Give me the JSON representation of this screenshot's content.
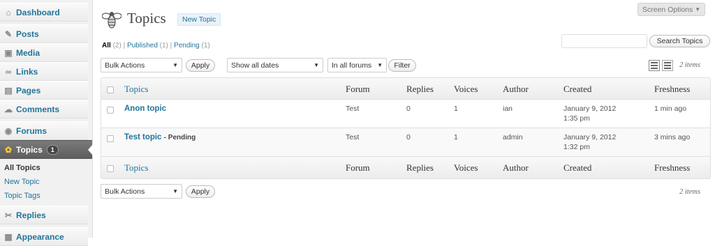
{
  "sidebar": {
    "items": [
      {
        "label": "Dashboard",
        "icon": "home-icon"
      },
      {
        "label": "Posts",
        "icon": "pin-icon"
      },
      {
        "label": "Media",
        "icon": "media-icon"
      },
      {
        "label": "Links",
        "icon": "link-icon"
      },
      {
        "label": "Pages",
        "icon": "pages-icon"
      },
      {
        "label": "Comments",
        "icon": "comment-icon"
      },
      {
        "label": "Forums",
        "icon": "forums-icon"
      },
      {
        "label": "Topics",
        "icon": "topics-icon",
        "badge": "1"
      },
      {
        "label": "Replies",
        "icon": "replies-icon"
      },
      {
        "label": "Appearance",
        "icon": "appearance-icon"
      }
    ],
    "submenu": [
      "All Topics",
      "New Topic",
      "Topic Tags"
    ]
  },
  "screen_options": "Screen Options",
  "page": {
    "title": "Topics",
    "add_new": "New Topic"
  },
  "filters": {
    "all": "All",
    "all_count": "(2)",
    "published": "Published",
    "published_count": "(1)",
    "pending": "Pending",
    "pending_count": "(1)"
  },
  "search": {
    "button": "Search Topics",
    "value": ""
  },
  "toolbar": {
    "bulk": "Bulk Actions",
    "apply": "Apply",
    "dates": "Show all dates",
    "forums": "In all forums",
    "filter": "Filter",
    "items": "2 items"
  },
  "columns": [
    "Topics",
    "Forum",
    "Replies",
    "Voices",
    "Author",
    "Created",
    "Freshness"
  ],
  "rows": [
    {
      "title": "Anon topic",
      "status": "",
      "forum": "Test",
      "replies": "0",
      "voices": "1",
      "author": "ian",
      "created_date": "January 9, 2012",
      "created_time": "1:35 pm",
      "freshness": "1 min ago"
    },
    {
      "title": "Test topic",
      "status": "- Pending",
      "forum": "Test",
      "replies": "0",
      "voices": "1",
      "author": "admin",
      "created_date": "January 9, 2012",
      "created_time": "1:32 pm",
      "freshness": "3 mins ago"
    }
  ],
  "colors": {
    "link": "#21759b",
    "active_menu": "#6d6d6d"
  }
}
